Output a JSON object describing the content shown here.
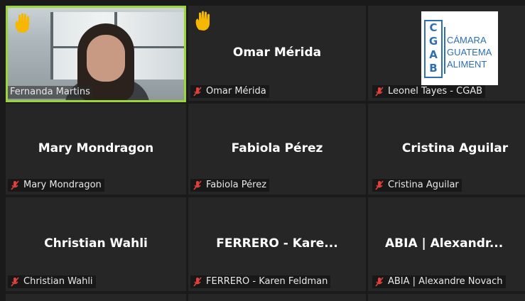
{
  "participants": [
    {
      "display": "",
      "label": "Fernanda Martins",
      "hand_raised": true,
      "muted": false,
      "has_video": true,
      "active_speaker": true
    },
    {
      "display": "Omar Mérida",
      "label": "Omar Mérida",
      "hand_raised": true,
      "muted": true
    },
    {
      "display": "",
      "label": "Leonel Tayes - CGAB",
      "hand_raised": false,
      "muted": true,
      "has_logo": true
    },
    {
      "display": "Mary Mondragon",
      "label": "Mary Mondragon",
      "hand_raised": false,
      "muted": true
    },
    {
      "display": "Fabiola Pérez",
      "label": "Fabiola Pérez",
      "hand_raised": false,
      "muted": true
    },
    {
      "display": "Cristina Aguilar",
      "label": "Cristina Aguilar",
      "hand_raised": false,
      "muted": true
    },
    {
      "display": "Christian Wahli",
      "label": "Christian Wahli",
      "hand_raised": false,
      "muted": true
    },
    {
      "display": "FERRERO - Kare...",
      "label": "FERRERO - Karen Feldman",
      "hand_raised": false,
      "muted": true
    },
    {
      "display": "ABIA | Alexandr...",
      "label": "ABIA | Alexandre Novach",
      "hand_raised": false,
      "muted": true
    }
  ],
  "logo": {
    "mark_letters": [
      "C",
      "G",
      "A",
      "B"
    ],
    "lines": [
      "CÁMARA",
      "GUATEMA",
      "ALIMENT"
    ]
  },
  "colors": {
    "active_border": "#9bd53c",
    "muted_mic": "#e0403a",
    "raised_hand": "#f5b700",
    "tile_bg": "#262626",
    "logo_blue": "#2c6fb5"
  },
  "icons": {
    "raised_hand": "raised-hand-icon",
    "muted_mic": "muted-mic-icon"
  }
}
